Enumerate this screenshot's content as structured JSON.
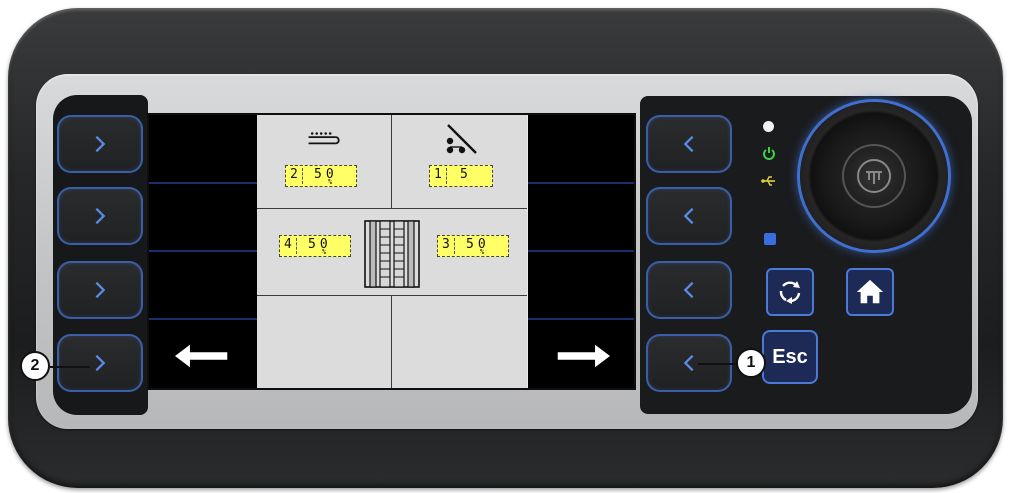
{
  "screen": {
    "top_left": {
      "icon": "conveyor-belt-icon",
      "value_a": "2",
      "value_b": "50",
      "unit": "%"
    },
    "top_right": {
      "icon": "spread-angle-icon",
      "value_a": "1",
      "value_b": "5"
    },
    "mid_left": {
      "value_a": "4",
      "value_b": "50",
      "unit": "%"
    },
    "mid_center": {
      "icon": "spreader-discs-icon"
    },
    "mid_right": {
      "value_a": "3",
      "value_b": "50",
      "unit": "%"
    },
    "softkey_left_bottom": {
      "icon": "arrow-left-icon"
    },
    "softkey_right_bottom": {
      "icon": "arrow-right-icon"
    }
  },
  "controls": {
    "esc_label": "Esc",
    "rotate_icon": "rotate-arrows-icon",
    "home_icon": "home-icon",
    "knob_logo": "brand-logo-icon"
  },
  "callouts": {
    "one": "1",
    "two": "2"
  },
  "colors": {
    "softkey_border": "#3a5ea8",
    "value_box": "#ffff66",
    "led_green": "#3fd14a",
    "led_blue": "#3a6ee0"
  }
}
